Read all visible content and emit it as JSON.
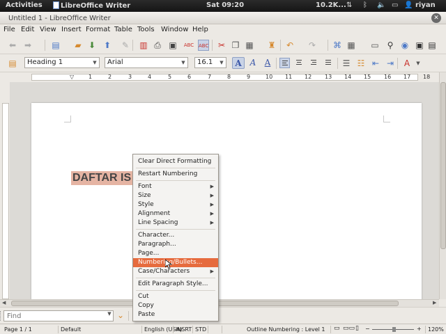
{
  "top_panel": {
    "activities": "Activities",
    "app": "LibreOffice Writer",
    "clock": "Sat 09:20",
    "network": "10.2K...",
    "user": "riyan"
  },
  "window": {
    "title": "Untitled 1 - LibreOffice Writer"
  },
  "menu": [
    "File",
    "Edit",
    "View",
    "Insert",
    "Format",
    "Table",
    "Tools",
    "Window",
    "Help"
  ],
  "formatting": {
    "style": "Heading 1",
    "font": "Arial",
    "size": "16.1"
  },
  "ruler_numbers": [
    "1",
    "2",
    "3",
    "4",
    "5",
    "6",
    "7",
    "8",
    "9",
    "10",
    "11",
    "12",
    "13",
    "14",
    "15",
    "16",
    "17",
    "18"
  ],
  "document": {
    "heading_text": "DAFTAR IS"
  },
  "context_menu": [
    {
      "label": "Clear Direct Formatting",
      "submenu": false
    },
    {
      "label": "Restart Numbering",
      "submenu": false
    },
    {
      "label": "Font",
      "submenu": true
    },
    {
      "label": "Size",
      "submenu": true
    },
    {
      "label": "Style",
      "submenu": true
    },
    {
      "label": "Alignment",
      "submenu": true
    },
    {
      "label": "Line Spacing",
      "submenu": true
    },
    {
      "label": "Character...",
      "submenu": false
    },
    {
      "label": "Paragraph...",
      "submenu": false
    },
    {
      "label": "Page...",
      "submenu": false
    },
    {
      "label": "Numbering/Bullets...",
      "submenu": false,
      "highlighted": true
    },
    {
      "label": "Case/Characters",
      "submenu": true
    },
    {
      "label": "Edit Paragraph Style...",
      "submenu": false
    },
    {
      "label": "Cut",
      "submenu": false
    },
    {
      "label": "Copy",
      "submenu": false
    },
    {
      "label": "Paste",
      "submenu": false
    }
  ],
  "find": {
    "placeholder": "Find"
  },
  "status": {
    "page": "Page 1 / 1",
    "style": "Default",
    "language": "English (USA)",
    "insert_mode": "INSRT",
    "selection_mode": "STD",
    "outline": "Outline Numbering : Level 1",
    "zoom": "120%"
  },
  "colors": {
    "highlight": "#e66b3e",
    "heading_bg": "#e5b4a3",
    "panel": "#1e1e1e"
  }
}
